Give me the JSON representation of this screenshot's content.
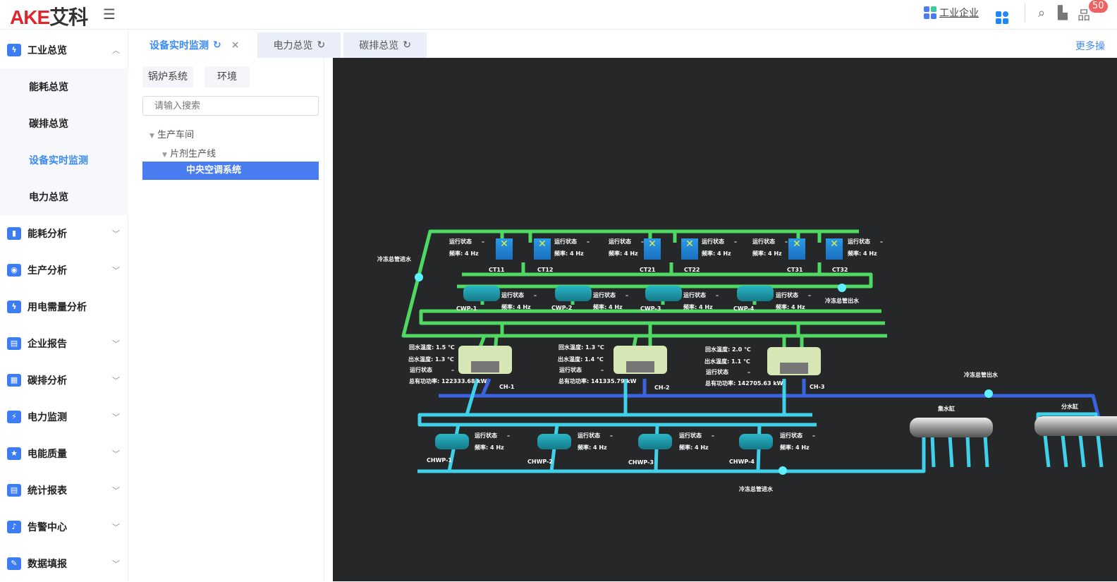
{
  "header": {
    "logo_latin": "AKE",
    "logo_cn": "艾科",
    "enterprise": "工业企业",
    "notification_count": "50",
    "more_ops": "更多操"
  },
  "sidebar": {
    "group": {
      "label": "工业总览",
      "children": [
        "能耗总览",
        "碳排总览",
        "设备实时监测",
        "电力总览"
      ],
      "active": "设备实时监测"
    },
    "items": [
      {
        "label": "能耗分析",
        "chevron": true
      },
      {
        "label": "生产分析",
        "chevron": true
      },
      {
        "label": "用电需量分析",
        "chevron": false
      },
      {
        "label": "企业报告",
        "chevron": true
      },
      {
        "label": "碳排分析",
        "chevron": true
      },
      {
        "label": "电力监测",
        "chevron": true
      },
      {
        "label": "电能质量",
        "chevron": true
      },
      {
        "label": "统计报表",
        "chevron": true
      },
      {
        "label": "告警中心",
        "chevron": true
      },
      {
        "label": "数据填报",
        "chevron": true
      }
    ]
  },
  "tabs": [
    {
      "label": "设备实时监测",
      "active": true,
      "closable": true
    },
    {
      "label": "电力总览",
      "active": false
    },
    {
      "label": "碳排总览",
      "active": false
    }
  ],
  "panel": {
    "buttons": [
      "锅炉系统",
      "环境"
    ],
    "search_placeholder": "请输入搜索",
    "tree": [
      "生产车间",
      "片剂生产线",
      "中央空调系统"
    ],
    "selected": "中央空调系统"
  },
  "diagram": {
    "status_label": "运行状态",
    "status_value": "–",
    "freq_text": "频率: 4 Hz",
    "cooling_towers": [
      "CT11",
      "CT12",
      "CT21",
      "CT22",
      "CT31",
      "CT32"
    ],
    "cooling_pumps": [
      "CWP-1",
      "CWP-2",
      "CWP-3",
      "CWP-4"
    ],
    "chilled_pumps": [
      "CHWP-1",
      "CHWP-2",
      "CHWP-3",
      "CHWP-4"
    ],
    "chillers": [
      {
        "name": "CH-1",
        "return_temp": "回水温度: 1.5 ℃",
        "supply_temp": "出水温度: 1.3 ℃",
        "power": "总有功功率: 122333.68 kW"
      },
      {
        "name": "CH-2",
        "return_temp": "回水温度: 1.3 ℃",
        "supply_temp": "出水温度: 1.4 ℃",
        "power": "总有功功率: 141335.79 kW"
      },
      {
        "name": "CH-3",
        "return_temp": "回水温度: 2.0 ℃",
        "supply_temp": "出水温度: 1.1 ℃",
        "power": "总有功功率: 142705.63 kW"
      }
    ],
    "tanks": [
      "集水缸",
      "分水缸"
    ],
    "pipe_labels": [
      "冷冻总管进水",
      "冷冻总管出水",
      "冷冻总管出水",
      "冷冻总管进水"
    ],
    "colors": {
      "cooling_pipe": "#4fd862",
      "chilled_supply": "#3a63e0",
      "chilled_return": "#3fd0ea",
      "background": "#262729"
    }
  }
}
